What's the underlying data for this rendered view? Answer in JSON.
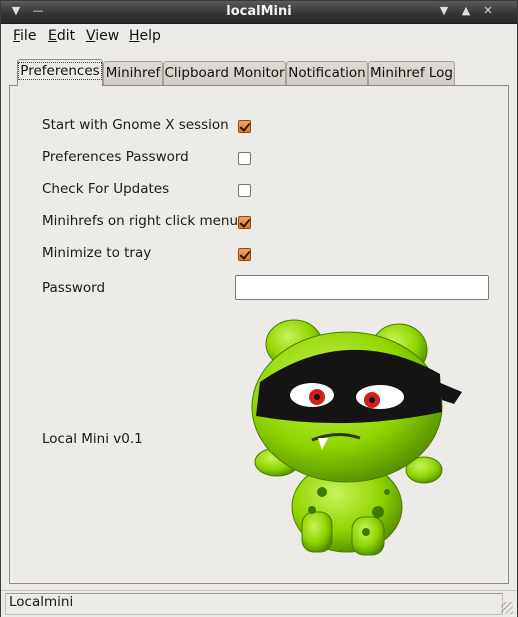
{
  "window": {
    "title": "localMini"
  },
  "menu": [
    {
      "label": "File",
      "mnemonic": "F",
      "rest": "ile"
    },
    {
      "label": "Edit",
      "mnemonic": "E",
      "rest": "dit"
    },
    {
      "label": "View",
      "mnemonic": "V",
      "rest": "iew"
    },
    {
      "label": "Help",
      "mnemonic": "H",
      "rest": "elp"
    }
  ],
  "tabs": [
    "Preferences",
    "Minihref",
    "Clipboard Monitor",
    "Notification",
    "Minihref Log"
  ],
  "active_tab": "Preferences",
  "preferences": {
    "rows": [
      {
        "label": "Start with Gnome X session",
        "checked": true
      },
      {
        "label": "Preferences Password",
        "checked": false
      },
      {
        "label": "Check For Updates",
        "checked": false
      },
      {
        "label": "Minihrefs on right click menu",
        "checked": true
      },
      {
        "label": "Minimize to tray",
        "checked": true
      }
    ],
    "password_label": "Password",
    "password_value": "",
    "version": "Local Mini v0.1"
  },
  "statusbar": {
    "text": "Localmini"
  },
  "colors": {
    "checkbox_on": "#e07a2c",
    "mascot_green": "#8fd400",
    "titlebar": "#333333"
  }
}
